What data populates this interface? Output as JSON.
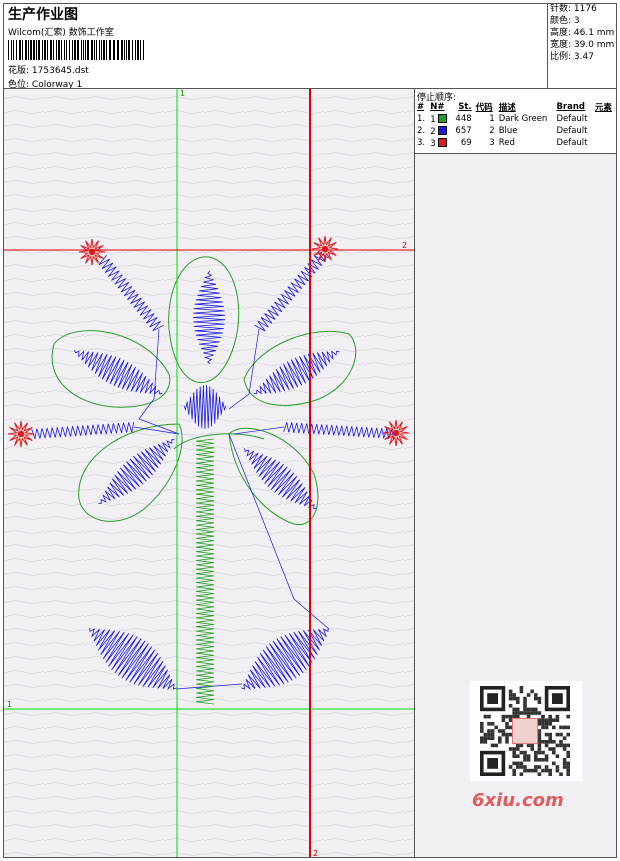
{
  "header": {
    "title": "生产作业图",
    "subtitle": "Wilcom(汇索) 数饰工作室",
    "design_label": "花版:",
    "design_value": "1753645.dst",
    "colorway_label": "色位:",
    "colorway_value": "Colorway 1"
  },
  "stats": {
    "stitches": "针数: 1176",
    "colors": "颜色: 3",
    "height": "高度: 46.1 mm",
    "width": "宽度: 39.0 mm",
    "scale": "比例: 3.47"
  },
  "stop_sequence": {
    "title": "停止顺序:",
    "headers": [
      "#",
      "N#",
      "St.",
      "代码",
      "描述",
      "Brand",
      "元素"
    ],
    "rows": [
      {
        "num": "1.",
        "n": "1",
        "color": "#22a022",
        "st": "448",
        "code": "1",
        "desc": "Dark Green",
        "brand": "Default"
      },
      {
        "num": "2.",
        "n": "2",
        "color": "#1a1ae0",
        "st": "657",
        "code": "2",
        "desc": "Blue",
        "brand": "Default"
      },
      {
        "num": "3.",
        "n": "3",
        "color": "#e01a1a",
        "st": "69",
        "code": "3",
        "desc": "Red",
        "brand": "Default"
      }
    ]
  },
  "guides": {
    "green_v_label": "1",
    "green_h_label": "1",
    "red_v_label": "2",
    "red_h_label": "2"
  },
  "watermark": {
    "logo_text": "6xiu.com"
  },
  "colors": {
    "green": "#22a022",
    "blue": "#1a1ae0",
    "red": "#e01a1a"
  }
}
